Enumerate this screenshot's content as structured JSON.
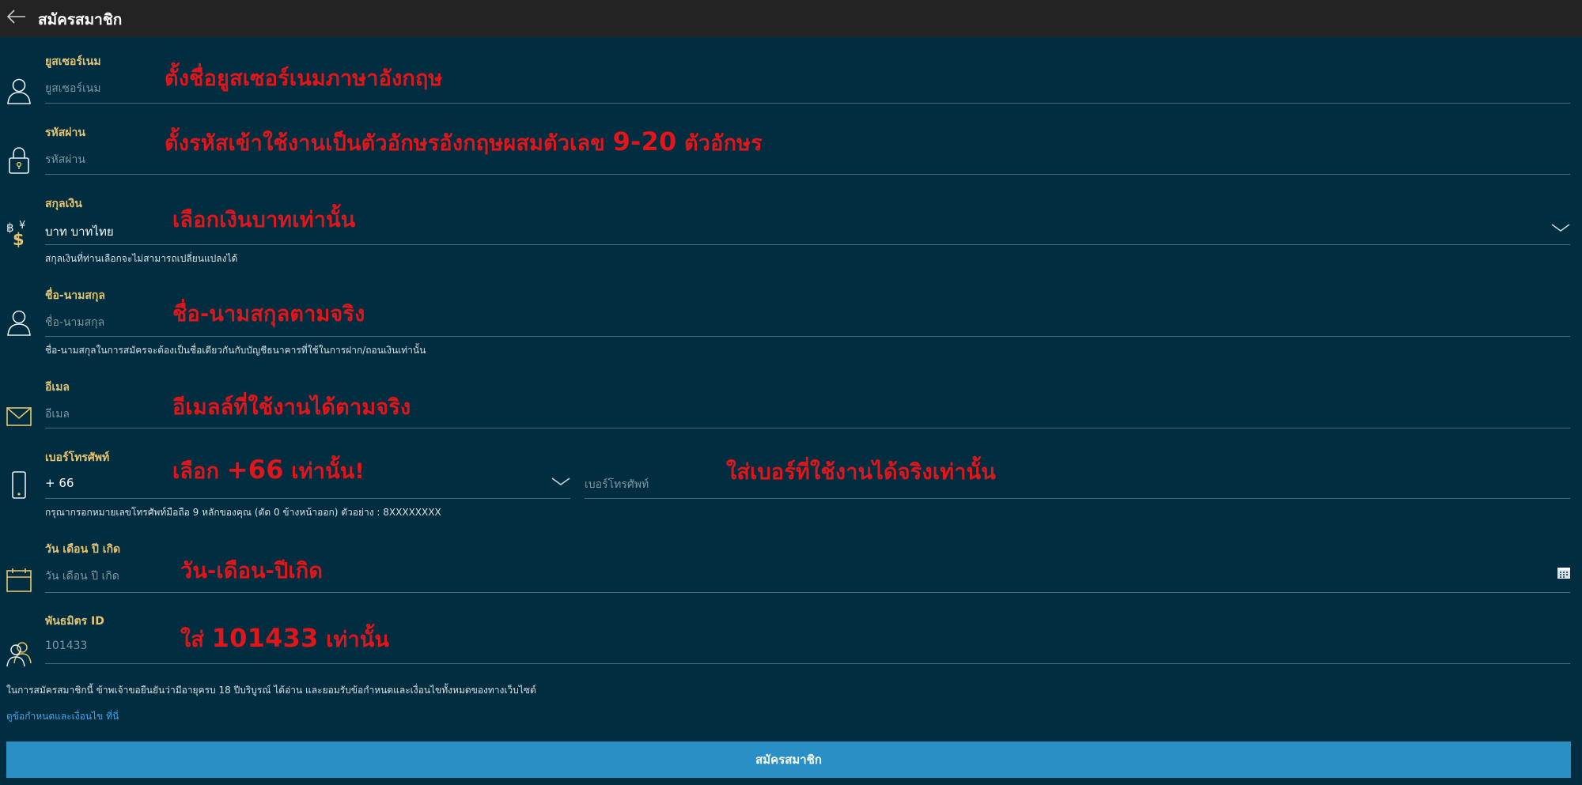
{
  "header": {
    "title": "สมัครสมาชิก"
  },
  "fields": {
    "username": {
      "label": "ยูสเซอร์เนม",
      "placeholder": "ยูสเซอร์เนม",
      "annotation": "ตั้งชื่อยูสเซอร์เนมภาษาอังกฤษ"
    },
    "password": {
      "label": "รหัสผ่าน",
      "placeholder": "รหัสผ่าน",
      "annotation_pre": "ตั้งรหัสเข้าใช้งานเป็นตัวอักษรอังกฤษผสมตัวเลข ",
      "annotation_num": "9-20",
      "annotation_post": " ตัวอักษร"
    },
    "currency": {
      "label": "สกุลเงิน",
      "value": "บาท บาทไทย",
      "help": "สกุลเงินที่ท่านเลือกจะไม่สามารถเปลี่ยนแปลงได้",
      "annotation": "เลือกเงินบาทเท่านั้น"
    },
    "fullname": {
      "label": "ชื่อ-นามสกุล",
      "placeholder": "ชื่อ-นามสกุล",
      "help": "ชื่อ-นามสกุลในการสมัครจะต้องเป็นชื่อเดียวกันกับบัญชีธนาคารที่ใช้ในการฝาก/ถอนเงินเท่านั้น",
      "annotation": "ชื่อ-นามสกุลตามจริง"
    },
    "email": {
      "label": "อีเมล",
      "placeholder": "อีเมล",
      "annotation": "อีเมลล์ที่ใช้งานได้ตามจริง"
    },
    "phone": {
      "label": "เบอร์โทรศัพท์",
      "code": "+ 66",
      "placeholder": "เบอร์โทรศัพท์",
      "help": "กรุณากรอกหมายเลขโทรศัพท์มือถือ 9 หลักของคุณ (ตัด 0 ข้างหน้าออก) ตัวอย่าง : 8XXXXXXXX",
      "annotation_code_pre": "เลือก ",
      "annotation_code_num": "+66",
      "annotation_code_post": " เท่านั้น!",
      "annotation_number": "ใส่เบอร์ที่ใช้งานได้จริงเท่านั้น"
    },
    "birthdate": {
      "label": "วัน เดือน ปี เกิด",
      "placeholder": "วัน เดือน ปี เกิด",
      "annotation": "วัน-เดือน-ปีเกิด"
    },
    "affiliate": {
      "label": "พันธมิตร ID",
      "value": "101433",
      "annotation_pre": "ใส่ ",
      "annotation_num": "101433",
      "annotation_post": " เท่านั้น"
    }
  },
  "terms": {
    "text": "ในการสมัครสมาชิกนี้ ข้าพเจ้าขอยืนยันว่ามีอายุครบ 18 ปีบริบูรณ์ ได้อ่าน และยอมรับข้อกำหนดและเงื่อนไขทั้งหมดของทางเว็บไซต์",
    "link": "ดูข้อกำหนดและเงื่อนไข ที่นี่"
  },
  "submit": {
    "label": "สมัครสมาชิก"
  },
  "colors": {
    "background": "#012d40",
    "header": "#232323",
    "label": "#e6c46f",
    "annotation": "#e0161b",
    "button": "#2a8fc4",
    "link": "#4aa3e0"
  }
}
